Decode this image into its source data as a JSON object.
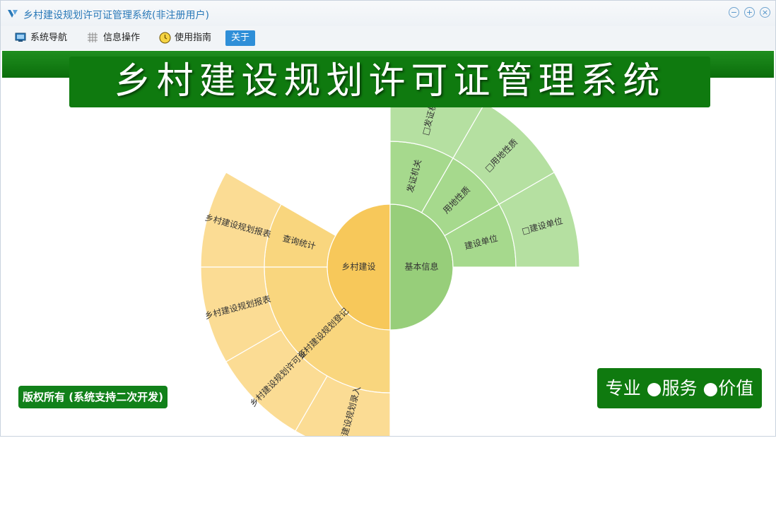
{
  "window": {
    "title": "乡村建设规划许可证管理系统(非注册用户)",
    "controls": {
      "minimize": "−",
      "maximize": "+",
      "close": "×"
    }
  },
  "menu": {
    "items": [
      {
        "label": "系统导航",
        "icon": "monitor-icon"
      },
      {
        "label": "信息操作",
        "icon": "grid-icon"
      },
      {
        "label": "使用指南",
        "icon": "clock-icon"
      },
      {
        "label": "关于",
        "icon": ""
      }
    ],
    "active_index": 3
  },
  "banner": {
    "title": "乡村建设规划许可证管理系统"
  },
  "footer": {
    "copyright": "版权所有 (系统支持二次开发)",
    "slogan": "专业 ●服务 ●价值"
  },
  "colors": {
    "brand_green": "#0f7a0f",
    "menu_active": "#2f8fd8",
    "orange_center": "#f7c85a",
    "orange_mid": "#f9d67e",
    "orange_outer": "#fbdc94",
    "green_center": "#97ce7a",
    "green_mid": "#a6d98d",
    "green_outer": "#b5e0a1"
  },
  "sunburst": {
    "left": {
      "center": "乡村建设",
      "ring1": [
        "查询统计",
        "乡村建设规划登记"
      ],
      "ring2": [
        "乡村建设规划报表",
        "乡村建设规划报表",
        "乡村建设规划许可证",
        "乡村建设规划录入"
      ]
    },
    "right": {
      "center": "基本信息",
      "ring1": [
        "建设单位",
        "用地性质",
        "发证机关"
      ],
      "ring2": [
        "建设单位",
        "用地性质",
        "发证机关"
      ]
    }
  }
}
